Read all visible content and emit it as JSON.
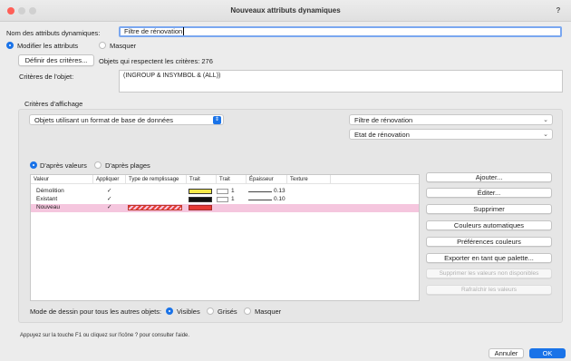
{
  "window": {
    "title": "Nouveaux attributs dynamiques",
    "help": "?"
  },
  "name": {
    "label": "Nom des attributs dynamiques:",
    "value": "Filtre de rénovation"
  },
  "mode": {
    "modify": "Modifier les attributs",
    "mask": "Masquer",
    "selected": "modify"
  },
  "criteria": {
    "define_button": "Définir des critères...",
    "count_text": "Objets qui respectent les critères: 276",
    "object_label": "Critères de l'objet:",
    "object_value": "(INGROUP & INSYMBOL & (ALL))"
  },
  "display": {
    "section_title": "Critères d'affichage",
    "source_select": "Objets utilisant un format de base de données",
    "record_select": "Filtre de rénovation",
    "field_select": "Etat de rénovation",
    "by_values": "D'après valeurs",
    "by_ranges": "D'après plages",
    "selected": "by_values"
  },
  "table": {
    "columns": [
      "Valeur",
      "Appliquer",
      "Type de remplissage",
      "Trait",
      "Trait",
      "Épaisseur",
      "Texture"
    ],
    "rows": [
      {
        "value": "Démolition",
        "apply": "✓",
        "fill": "#f5e94a",
        "thickness": "0.13",
        "stroke_count": "1",
        "selected": false
      },
      {
        "value": "Existant",
        "apply": "✓",
        "fill": "#111111",
        "thickness": "0.10",
        "stroke_count": "1",
        "selected": false
      },
      {
        "value": "Nouveau",
        "apply": "✓",
        "fill": "#e53935",
        "thickness": "",
        "stroke_count": "",
        "selected": true
      }
    ]
  },
  "side_buttons": {
    "add": "Ajouter...",
    "edit": "Éditer...",
    "delete": "Supprimer",
    "auto_colors": "Couleurs automatiques",
    "color_prefs": "Préférences couleurs",
    "export_palette": "Exporter en tant que palette...",
    "remove_unavailable": "Supprimer les valeurs non disponibles",
    "refresh": "Rafraîchir les valeurs"
  },
  "draw_mode": {
    "label": "Mode de dessin pour tous les autres objets:",
    "visible": "Visibles",
    "greyed": "Grisés",
    "hidden": "Masquer",
    "selected": "visible"
  },
  "status_text": "Appuyez sur la touche F1 ou cliquez sur l'icône ? pour consulter l'aide.",
  "footer": {
    "cancel": "Annuler",
    "ok": "OK"
  },
  "colors": {
    "accent": "#1a73e8",
    "selected_row": "#f5c6de"
  }
}
